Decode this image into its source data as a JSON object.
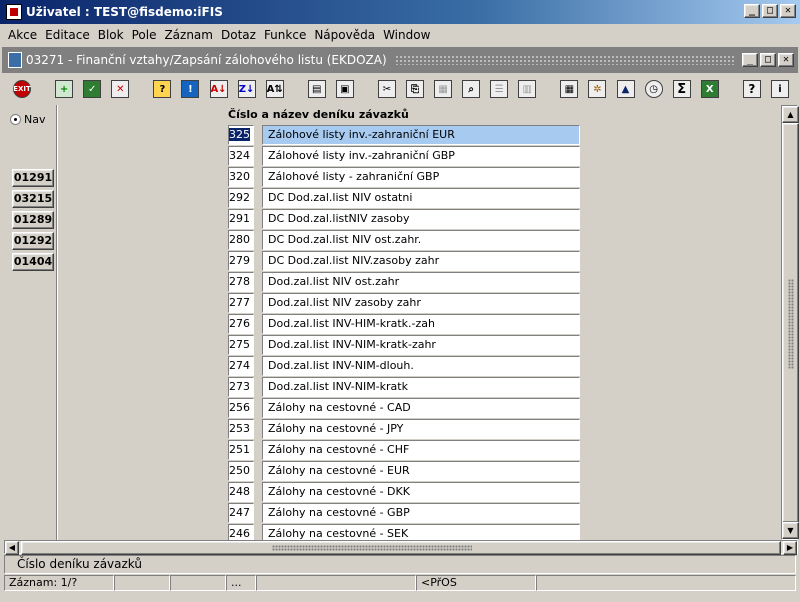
{
  "window": {
    "title": "Uživatel : TEST@fisdemo:iFIS",
    "min": "_",
    "max": "□",
    "close": "✕"
  },
  "menu": [
    "Akce",
    "Editace",
    "Blok",
    "Pole",
    "Záznam",
    "Dotaz",
    "Funkce",
    "Nápověda",
    "Window"
  ],
  "form": {
    "title": "03271 - Finanční vztahy/Zapsání zálohového listu (EKDOZA)"
  },
  "toolbar": {
    "exit_label": "EXIT",
    "icons": [
      "exit-icon",
      "insert-record-icon",
      "save-record-icon",
      "delete-record-icon",
      "enter-query-icon",
      "execute-query-icon",
      "sort-asc-icon",
      "sort-desc-icon",
      "sort-multi-icon",
      "print-icon",
      "print-preview-icon",
      "cut-icon",
      "copy-icon",
      "paste-icon",
      "find-icon",
      "list-icon",
      "columns-icon",
      "calculator-icon",
      "settings-icon",
      "chart-icon",
      "clock-icon",
      "sum-icon",
      "excel-icon",
      "help-icon",
      "info-icon"
    ]
  },
  "nav": {
    "radio_label": "Nav",
    "buttons": [
      "01291",
      "03215",
      "01289",
      "01292",
      "01404"
    ]
  },
  "list": {
    "header": "Číslo a název deníku závazků",
    "rows": [
      {
        "num": "325",
        "name": "Zálohové listy inv.-zahraniční EUR"
      },
      {
        "num": "324",
        "name": "Zálohové listy inv.-zahraniční GBP"
      },
      {
        "num": "320",
        "name": "Zálohové listy - zahraniční GBP"
      },
      {
        "num": "292",
        "name": "DC Dod.zal.list NIV ostatni"
      },
      {
        "num": "291",
        "name": "DC Dod.zal.listNIV zasoby"
      },
      {
        "num": "280",
        "name": "DC Dod.zal.list NIV ost.zahr."
      },
      {
        "num": "279",
        "name": "DC Dod.zal.list NIV.zasoby zahr"
      },
      {
        "num": "278",
        "name": "Dod.zal.list NIV ost.zahr"
      },
      {
        "num": "277",
        "name": "Dod.zal.list NIV zasoby zahr"
      },
      {
        "num": "276",
        "name": "Dod.zal.list INV-HIM-kratk.-zah"
      },
      {
        "num": "275",
        "name": "Dod.zal.list INV-NIM-kratk-zahr"
      },
      {
        "num": "274",
        "name": "Dod.zal.list INV-NIM-dlouh."
      },
      {
        "num": "273",
        "name": "Dod.zal.list INV-NIM-kratk"
      },
      {
        "num": "256",
        "name": "Zálohy na cestovné - CAD"
      },
      {
        "num": "253",
        "name": "Zálohy na cestovné - JPY"
      },
      {
        "num": "251",
        "name": "Zálohy na cestovné - CHF"
      },
      {
        "num": "250",
        "name": "Zálohy na cestovné - EUR"
      },
      {
        "num": "248",
        "name": "Zálohy na cestovné - DKK"
      },
      {
        "num": "247",
        "name": "Zálohy na cestovné - GBP"
      },
      {
        "num": "246",
        "name": "Zálohy na cestovné - SEK"
      }
    ]
  },
  "hint": "Číslo deníku závazků",
  "status": {
    "record": "Záznam: 1/?",
    "ellipsis": "...",
    "mode": "<PřOS"
  },
  "colors": {
    "titlebar": "#0a246a",
    "selection": "#a6caf0",
    "face": "#d4d0c8"
  }
}
